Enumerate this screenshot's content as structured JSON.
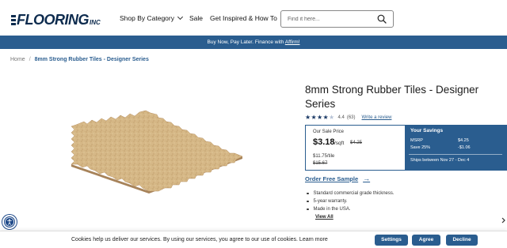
{
  "header": {
    "logo_main": "FLOORING",
    "logo_suffix": "INC",
    "nav": [
      {
        "label": "Shop By Category",
        "has_dropdown": true
      },
      {
        "label": "Sale",
        "has_dropdown": false
      },
      {
        "label": "Get Inspired & How To",
        "has_dropdown": false
      }
    ],
    "search_placeholder": "Find it here...",
    "search_icon": "magnifier-icon"
  },
  "promo": {
    "text": "Buy Now, Pay Later. Finance with ",
    "link": "Affirm!"
  },
  "breadcrumb": {
    "home": "Home",
    "separator": "/",
    "current": "8mm Strong Rubber Tiles - Designer Series"
  },
  "product": {
    "title": "8mm Strong Rubber Tiles - Designer Series",
    "rating": {
      "stars": 4.4,
      "value_text": "4.4",
      "count_text": "(63)",
      "review_link": "Write a review"
    },
    "price_box": {
      "label": "Our Sale Price",
      "price": "$3.18",
      "unit": "/sqft",
      "old_price": "$4.25",
      "tile_price": "$11.75/tile",
      "tile_old_price": "$15.67"
    },
    "savings": {
      "title": "Your Savings",
      "rows": [
        {
          "label": "MSRP",
          "value": "$4.25"
        },
        {
          "label": "Save 25%",
          "value": "-$1.06"
        }
      ],
      "shipping": "Ships between Nov 27 - Dec 4"
    },
    "sample_link": "Order Free Sample",
    "features": [
      "Standard commercial grade thickness.",
      "5-year warranty.",
      "Made in the USA."
    ],
    "view_all": "View All"
  },
  "cookie": {
    "text": "Cookies help us deliver our services. By using our services, you agree to our use of cookies. Learn more",
    "buttons": {
      "settings": "Settings",
      "agree": "Agree",
      "decline": "Decline"
    }
  },
  "colors": {
    "brand_navy": "#0d2b4e",
    "accent_blue": "#2a5d8f",
    "tile_color": "#d8b98a"
  }
}
